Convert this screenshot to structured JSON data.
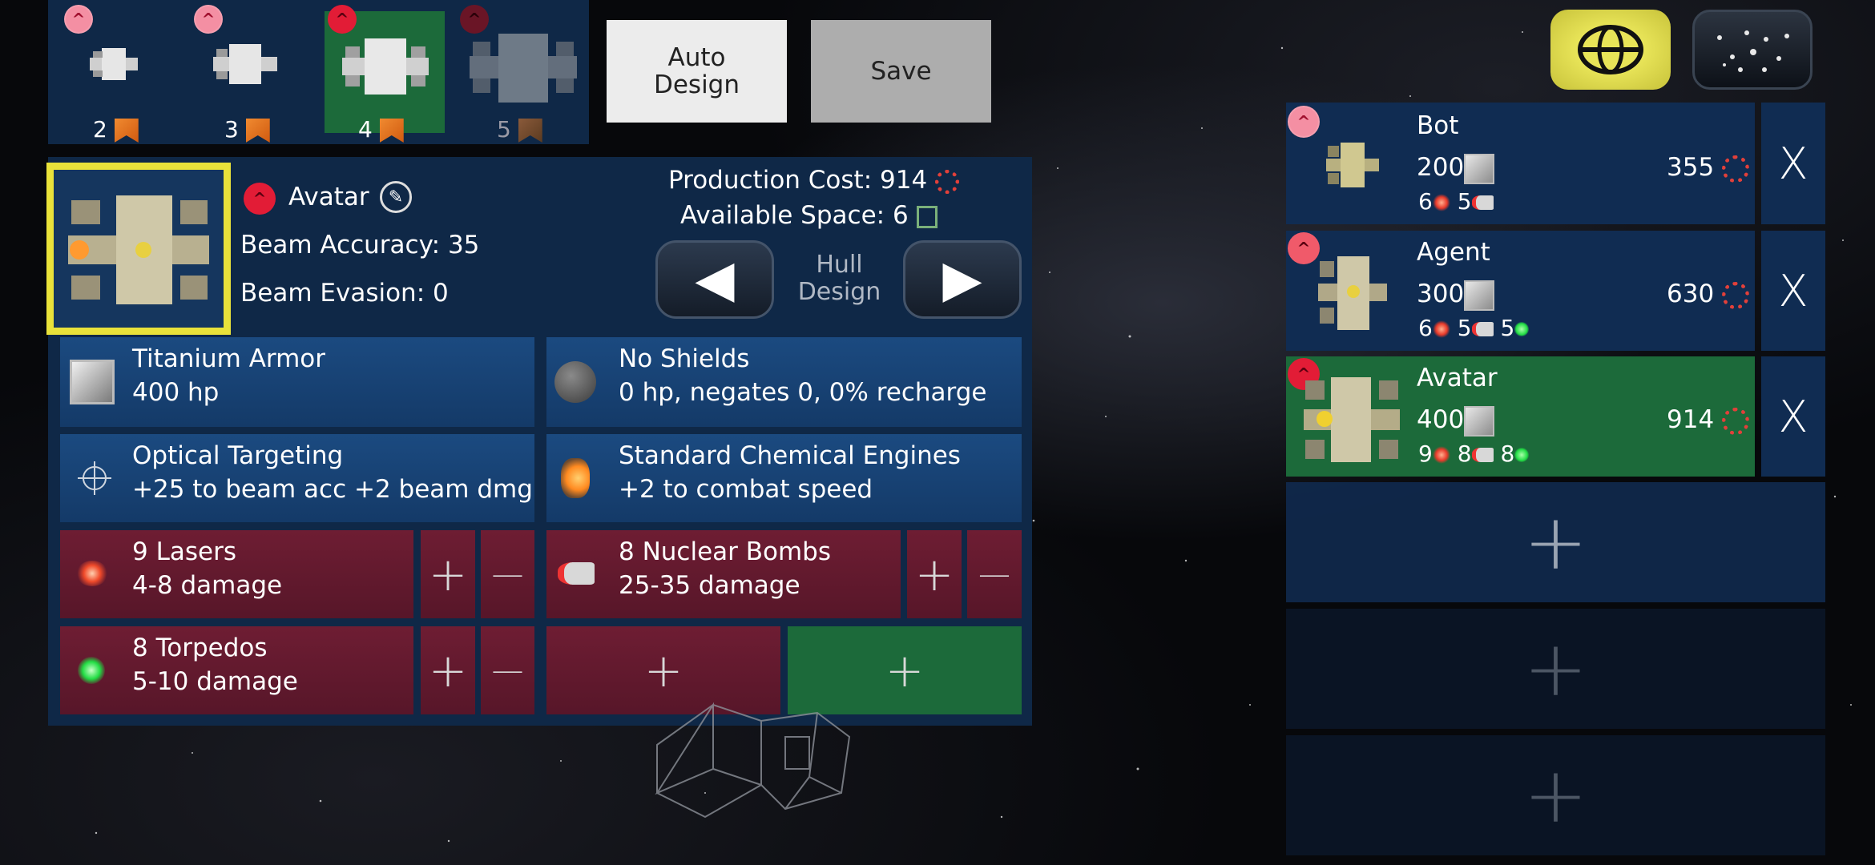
{
  "hull_slots": [
    {
      "number": "2",
      "rank": "^"
    },
    {
      "number": "3",
      "rank": "^^"
    },
    {
      "number": "4",
      "rank": "^^"
    },
    {
      "number": "5",
      "rank": "^^"
    }
  ],
  "buttons": {
    "auto_design_line1": "Auto",
    "auto_design_line2": "Design",
    "save": "Save",
    "hull_design_line1": "Hull",
    "hull_design_line2": "Design",
    "prev_arrow": "◀",
    "next_arrow": "▶",
    "plus": "+",
    "minus": "—",
    "delete": "X"
  },
  "design": {
    "name": "Avatar",
    "beam_accuracy": "Beam Accuracy: 35",
    "beam_evasion": "Beam Evasion: 0",
    "production_cost_label": "Production Cost:",
    "production_cost_value": "914",
    "available_space_label": "Available Space:",
    "available_space_value": "6"
  },
  "components": {
    "armor": {
      "title": "Titanium Armor",
      "detail": "400 hp"
    },
    "shields": {
      "title": "No Shields",
      "detail": "0 hp, negates 0, 0% recharge"
    },
    "targeting": {
      "title": "Optical Targeting",
      "detail": "+25 to beam acc +2 beam dmg"
    },
    "engines": {
      "title": "Standard Chemical Engines",
      "detail": "+2 to combat speed"
    },
    "lasers": {
      "title": "9 Lasers",
      "detail": "4-8 damage"
    },
    "bombs": {
      "title": "8 Nuclear Bombs",
      "detail": "25-35 damage"
    },
    "torpedos": {
      "title": "8 Torpedos",
      "detail": "5-10 damage"
    }
  },
  "saved_designs": [
    {
      "name": "Bot",
      "armor": "200",
      "cost": "355",
      "lasers": "6",
      "bombs": "5",
      "torpedos": ""
    },
    {
      "name": "Agent",
      "armor": "300",
      "cost": "630",
      "lasers": "6",
      "bombs": "5",
      "torpedos": "5"
    },
    {
      "name": "Avatar",
      "armor": "400",
      "cost": "914",
      "lasers": "9",
      "bombs": "8",
      "torpedos": "8"
    }
  ],
  "icons": {
    "top_right_1": "globe-ship-icon",
    "top_right_2": "star-map-icon"
  },
  "colors": {
    "selection_yellow": "#e9e23a",
    "panel_blue": "#0f2847",
    "weapon_red": "#5f192e",
    "active_green": "#1c6a3a",
    "cost_red": "#e2403a"
  }
}
